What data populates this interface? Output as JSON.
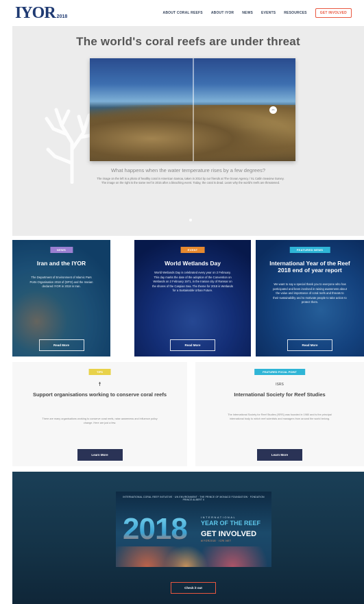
{
  "header": {
    "logo": "IYOR",
    "logo_year": "2018",
    "nav": [
      "ABOUT CORAL REEFS",
      "ABOUT IYOR",
      "NEWS",
      "EVENTS",
      "RESOURCES"
    ],
    "cta": "GET INVOLVED",
    "cta_color": "#e9573f"
  },
  "hero": {
    "title": "The world's coral reefs are under threat",
    "question": "What happens when the water temperature rises by a few degrees?",
    "description": "The image on the left is a photo of healthy coral in American Samoa, taken in 2014 by our friends at The Ocean Agency / XL Catlin Seaview Survey. The image on the right is the same reef in 2015 after a bleaching event. Today, the coral is dead. Learn why the world's reefs are threatened.",
    "slider_icon": "arrows-icon"
  },
  "cards": [
    {
      "badge": "NEWS",
      "badge_color": "#9b7fd1",
      "title": "Iran and the IYOR",
      "text": "The Department of Environment of Islamic Pars Ports Organisation 2018 of (DPO) and the Iranian declared IYOR in 2018 in Iran.",
      "button": "Read More"
    },
    {
      "badge": "EVENT",
      "badge_color": "#e6892f",
      "title": "World Wetlands Day",
      "text": "World Wetlands Day is celebrated every year on 2 February. This day marks the date of the adoption of the Convention on Wetlands on 2 February 1971, in the Iranian city of Ramsar on the shores of the Caspian Sea. The theme for 2018 is Wetlands for a Sustainable Urban Future.",
      "button": "Read More"
    },
    {
      "badge": "FEATURED NEWS",
      "badge_color": "#2fb5d6",
      "title": "International Year of the Reef 2018 end of year report",
      "text": "We want to say a special thank you to everyone who has participated and been involved in raising awareness about the value and importance of coral reefs and threats to their sustainability and to motivate people to take action to protect them.",
      "button": "Read More"
    }
  ],
  "support": {
    "badge": "TIPS",
    "badge_color": "#e8d24a",
    "icon": "person-icon",
    "title": "Support organisations working to conserve coral reefs",
    "text": "There are many organisations working to conserve coral reefs, raise awareness and influence policy change. Here are just a few.",
    "button": "Learn More"
  },
  "focal": {
    "badge": "FEATURED FOCAL POINT",
    "badge_color": "#2fb5d6",
    "icon": "isrs-logo-icon",
    "title": "International Society for Reef Studies",
    "text": "The International Society for Reef Studies (ISRS) was founded in 1980 and is the principal international body to which reef scientists and managers from around the world belong.",
    "button": "Learn More"
  },
  "banner": {
    "top_text": "INTERNATIONAL CORAL REEF INITIATIVE · UN ENVIRONMENT · THE PRINCE OF MONACO FOUNDATION · FONDATION PRINCE ALBERT II",
    "year": "2018",
    "intl": "INTERNATIONAL",
    "title": "YEAR OF THE REEF",
    "get_involved": "GET INVOLVED",
    "sub": "#IYOR2018 · ICRI.NET",
    "button": "Check it out"
  }
}
